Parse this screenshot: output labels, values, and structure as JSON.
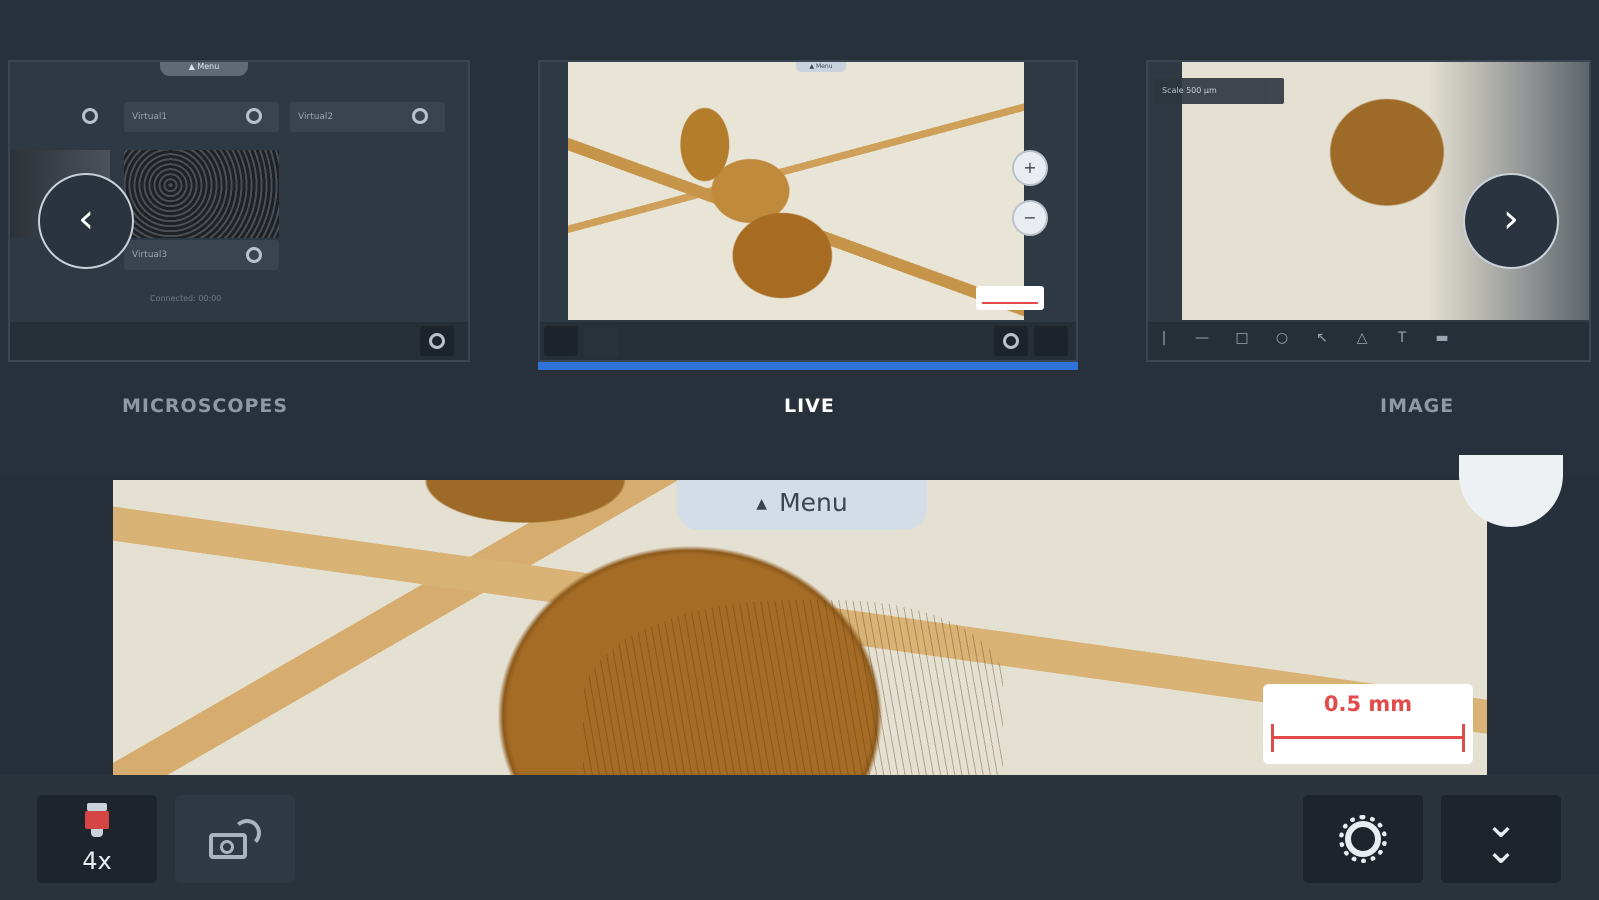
{
  "tabs": {
    "microscopes": "MICROSCOPES",
    "live": "LIVE",
    "image": "IMAGE"
  },
  "microscopes_card": {
    "menu_tab": "▲ Menu",
    "slots": [
      "Virtual1",
      "Virtual2",
      "Virtual3"
    ],
    "caption": "Connected: 00:00"
  },
  "live_card": {
    "menu_tab": "▲ Menu",
    "zoom_in_icon": "plus-circle-icon",
    "zoom_out_icon": "minus-circle-icon"
  },
  "image_card": {
    "header": "Scale 500 µm"
  },
  "main_view": {
    "menu_label": "Menu",
    "scale_label": "0.5 mm"
  },
  "toolbar": {
    "objective_label": "4x"
  },
  "colors": {
    "accent": "#2f72d8",
    "scale_red": "#e34b4b",
    "objective_red": "#d64545"
  }
}
